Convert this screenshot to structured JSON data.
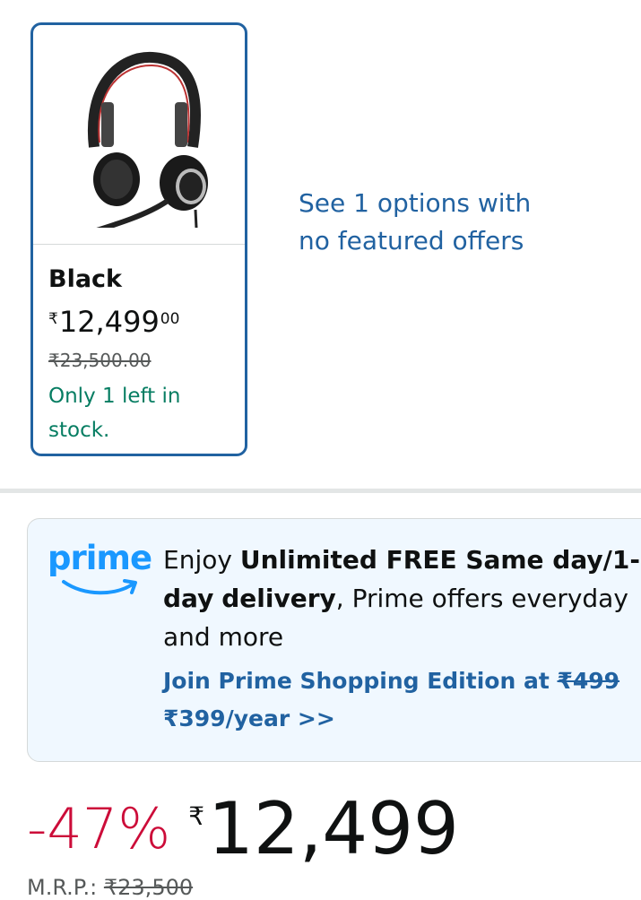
{
  "variant": {
    "color": "Black",
    "currency": "₹",
    "price_whole": "12,499",
    "price_fraction": "00",
    "mrp": "₹23,500.00",
    "stock": "Only 1 left in stock."
  },
  "see_options": "See 1 options with no featured offers",
  "prime": {
    "logo_text": "prime",
    "text_part1": "Enjoy ",
    "text_bold1": "Unlimited FREE Same day/1-day",
    "text_part2": " ",
    "text_bold2": "delivery",
    "text_part3": ", Prime offers everyday and more",
    "link_prefix": "Join Prime Shopping Edition at ",
    "link_old_price": "₹499",
    "link_new_price": "₹399/year >>"
  },
  "deal": {
    "discount": "-47%",
    "currency": "₹",
    "price": "12,499",
    "mrp_label": "M.R.P.: ",
    "mrp_value": "₹23,500"
  },
  "colors": {
    "accent_blue": "#2162a1",
    "stock_green": "#067d62",
    "discount_red": "#cc0c39",
    "prime_blue": "#1a98ff"
  }
}
